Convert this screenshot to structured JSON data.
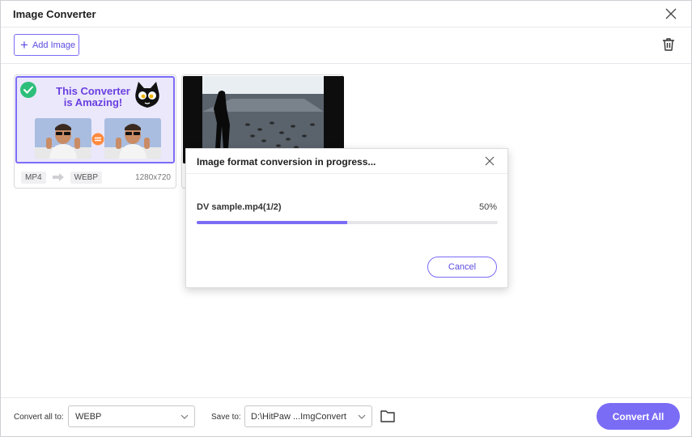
{
  "window": {
    "title": "Image Converter"
  },
  "toolbar": {
    "add_image_label": "Add Image",
    "add_icon": "plus-icon",
    "delete_icon": "trash-icon"
  },
  "cards": [
    {
      "headline_line1": "This Converter",
      "headline_line2": "is Amazing!",
      "source_format": "MP4",
      "target_format": "WEBP",
      "resolution": "1280x720",
      "selected": true
    },
    {
      "thumbnail": "lake-with-birds"
    }
  ],
  "dialog": {
    "title": "Image format conversion in progress...",
    "file_label": "DV sample.mp4(1/2)",
    "percent_label": "50%",
    "progress": 0.5,
    "cancel_label": "Cancel"
  },
  "bottom": {
    "convert_all_to_label": "Convert all to:",
    "format_value": "WEBP",
    "save_to_label": "Save to:",
    "path_value": "D:\\HitPaw ...ImgConvert",
    "convert_all_label": "Convert All"
  },
  "colors": {
    "accent": "#7b6cf6",
    "accent_text": "#5b4ce0",
    "check_green": "#2dbf7a"
  }
}
